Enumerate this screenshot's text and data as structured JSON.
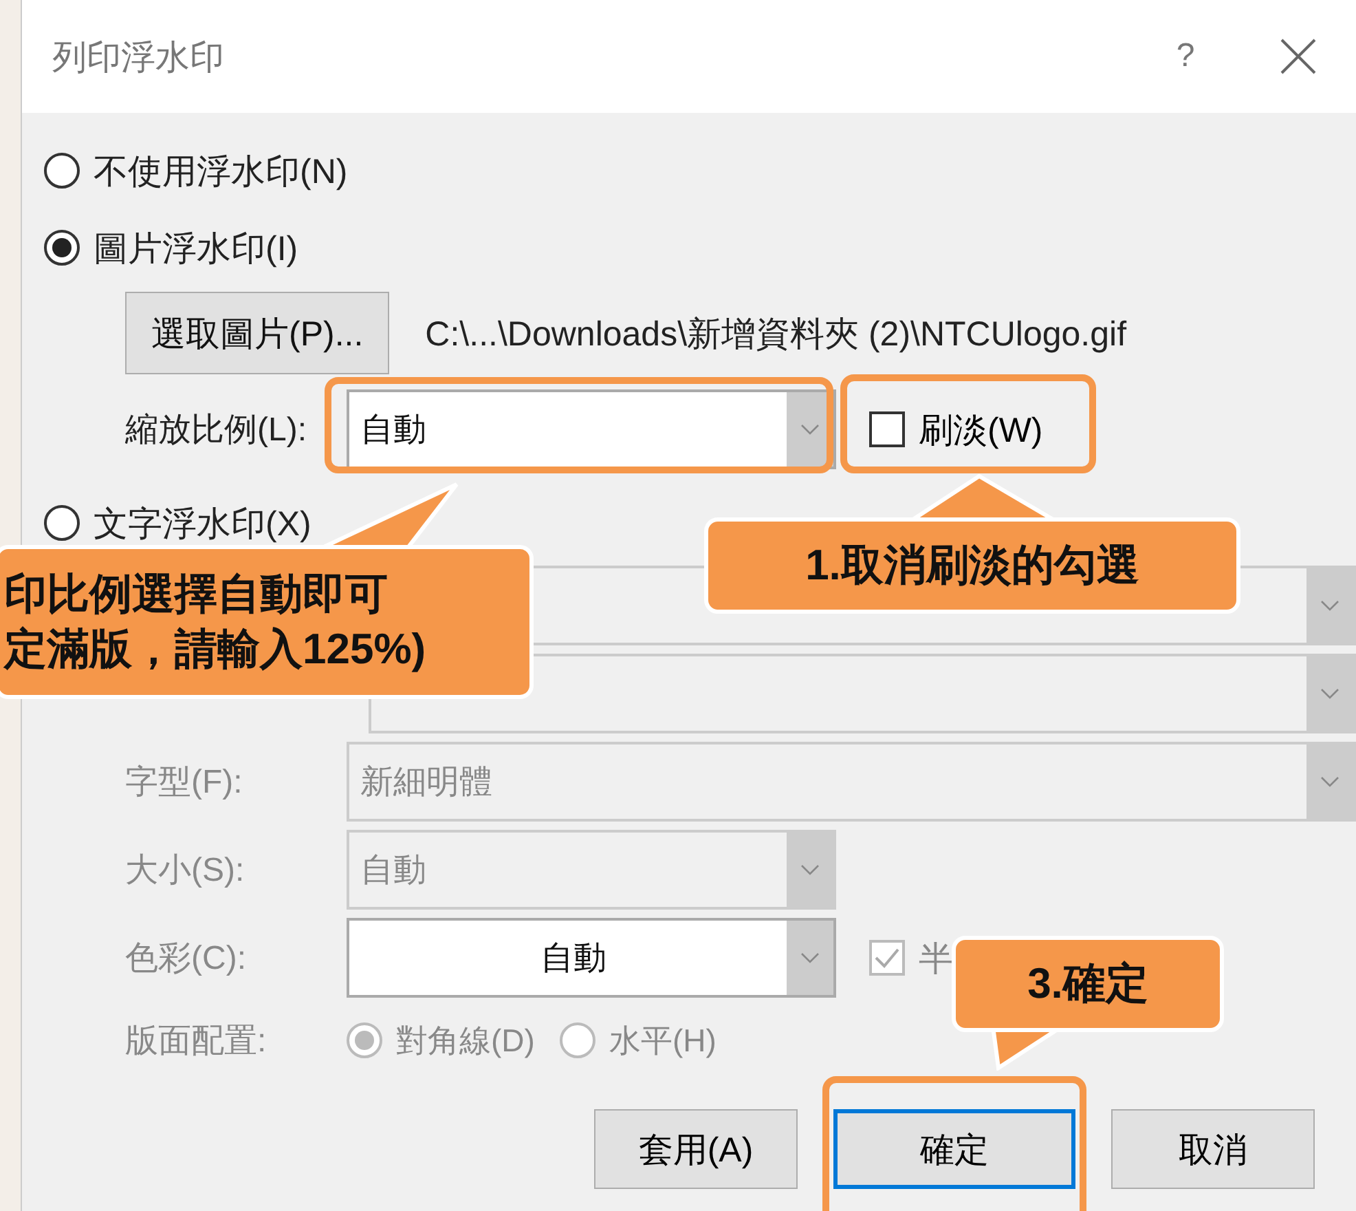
{
  "window": {
    "title": "列印浮水印",
    "help": "?"
  },
  "watermark_options": [
    {
      "label": "不使用浮水印(N)",
      "selected": false
    },
    {
      "label": "圖片浮水印(I)",
      "selected": true
    },
    {
      "label": "文字浮水印(X)",
      "selected": false
    }
  ],
  "picture": {
    "select_button": "選取圖片(P)...",
    "path": "C:\\...\\Downloads\\新增資料夾 (2)\\NTCUlogo.gif",
    "scale_label": "縮放比例(L):",
    "scale_value": "自動",
    "washout_label": "刷淡(W)",
    "washout_checked": false
  },
  "text": {
    "disabled": true,
    "font_label": "字型(F):",
    "font_value": "新細明體",
    "size_label": "大小(S):",
    "size_value": "自動",
    "color_label": "色彩(C):",
    "color_value": "自動",
    "semitransparent_label": "半",
    "semitransparent_checked": true,
    "layout_label": "版面配置:",
    "layouts": [
      {
        "label": "對角線(D)",
        "selected": true
      },
      {
        "label": "水平(H)",
        "selected": false
      }
    ]
  },
  "buttons": [
    {
      "label": "套用(A)",
      "focused": false
    },
    {
      "label": "確定",
      "focused": true
    },
    {
      "label": "取消",
      "focused": false
    }
  ],
  "callouts": [
    {
      "lines": [
        "1.取消刷淡的勾選"
      ]
    },
    {
      "lines": [
        "印比例選擇自動即可",
        "定滿版，請輸入125%)"
      ]
    },
    {
      "lines": [
        "3.確定"
      ]
    }
  ]
}
